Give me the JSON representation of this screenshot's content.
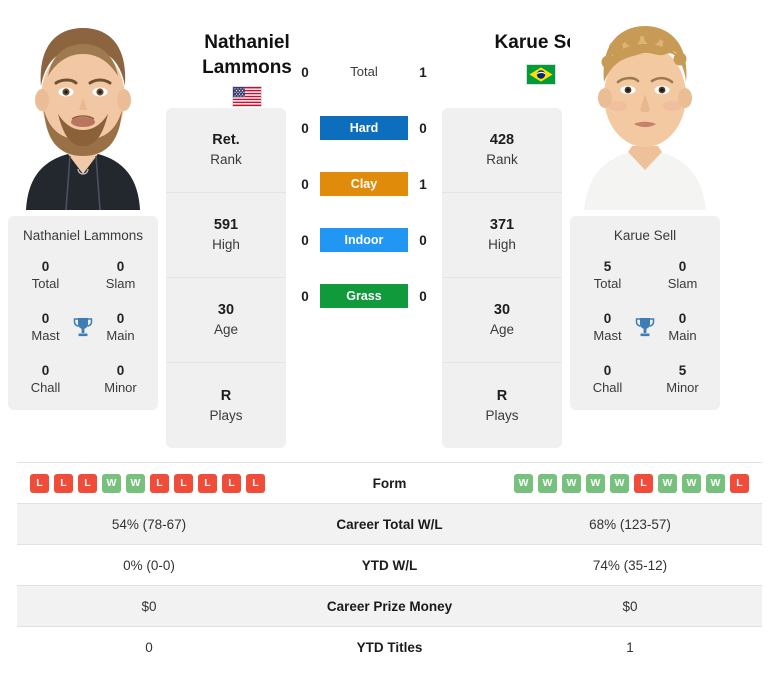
{
  "players": {
    "left": {
      "name": "Nathaniel Lammons",
      "name_line1": "Nathaniel",
      "name_line2": "Lammons",
      "country": "USA",
      "flag_icon": "flag-usa-icon",
      "rank": "Ret.",
      "rank_label": "Rank",
      "high": "591",
      "high_label": "High",
      "age": "30",
      "age_label": "Age",
      "plays": "R",
      "plays_label": "Plays",
      "titles": [
        {
          "num": "0",
          "label": "Total"
        },
        {
          "num": "0",
          "label": "Slam"
        },
        {
          "num": "0",
          "label": "Mast"
        },
        {
          "num": "0",
          "label": "Main"
        },
        {
          "num": "0",
          "label": "Chall"
        },
        {
          "num": "0",
          "label": "Minor"
        }
      ],
      "form": [
        "L",
        "L",
        "L",
        "W",
        "W",
        "L",
        "L",
        "L",
        "L",
        "L"
      ],
      "career_wl": "54% (78-67)",
      "ytd_wl": "0% (0-0)",
      "prize_money": "$0",
      "ytd_titles": "0"
    },
    "right": {
      "name": "Karue Sell",
      "name_line1": "Karue Sell",
      "name_line2": "",
      "country": "BRA",
      "flag_icon": "flag-brazil-icon",
      "rank": "428",
      "rank_label": "Rank",
      "high": "371",
      "high_label": "High",
      "age": "30",
      "age_label": "Age",
      "plays": "R",
      "plays_label": "Plays",
      "titles": [
        {
          "num": "5",
          "label": "Total"
        },
        {
          "num": "0",
          "label": "Slam"
        },
        {
          "num": "0",
          "label": "Mast"
        },
        {
          "num": "0",
          "label": "Main"
        },
        {
          "num": "0",
          "label": "Chall"
        },
        {
          "num": "5",
          "label": "Minor"
        }
      ],
      "form": [
        "W",
        "W",
        "W",
        "W",
        "W",
        "L",
        "W",
        "W",
        "W",
        "L"
      ],
      "career_wl": "68% (123-57)",
      "ytd_wl": "74% (35-12)",
      "prize_money": "$0",
      "ytd_titles": "1"
    }
  },
  "head_to_head": {
    "surfaces": [
      {
        "label": "Total",
        "left": "0",
        "right": "1",
        "color": "",
        "plain": true
      },
      {
        "label": "Hard",
        "left": "0",
        "right": "0",
        "color": "#0d6ebd",
        "plain": false
      },
      {
        "label": "Clay",
        "left": "0",
        "right": "1",
        "color": "#e08c0a",
        "plain": false
      },
      {
        "label": "Indoor",
        "left": "0",
        "right": "0",
        "color": "#2196f3",
        "plain": false
      },
      {
        "label": "Grass",
        "left": "0",
        "right": "0",
        "color": "#109a3c",
        "plain": false
      }
    ]
  },
  "comparison_rows": [
    {
      "key": "form",
      "label": "Form",
      "type": "badges",
      "alt": false
    },
    {
      "key": "career_wl",
      "label": "Career Total W/L",
      "type": "text",
      "alt": true
    },
    {
      "key": "ytd_wl",
      "label": "YTD W/L",
      "type": "text",
      "alt": false
    },
    {
      "key": "prize_money",
      "label": "Career Prize Money",
      "type": "text",
      "alt": true
    },
    {
      "key": "ytd_titles",
      "label": "YTD Titles",
      "type": "text",
      "alt": false
    }
  ],
  "colors": {
    "win_badge": "#78c07e",
    "loss_badge": "#ef4c3a",
    "hard": "#0d6ebd",
    "clay": "#e08c0a",
    "indoor": "#2196f3",
    "grass": "#109a3c",
    "card_bg": "#f0f0f0",
    "trophy": "#3f7cb4"
  }
}
